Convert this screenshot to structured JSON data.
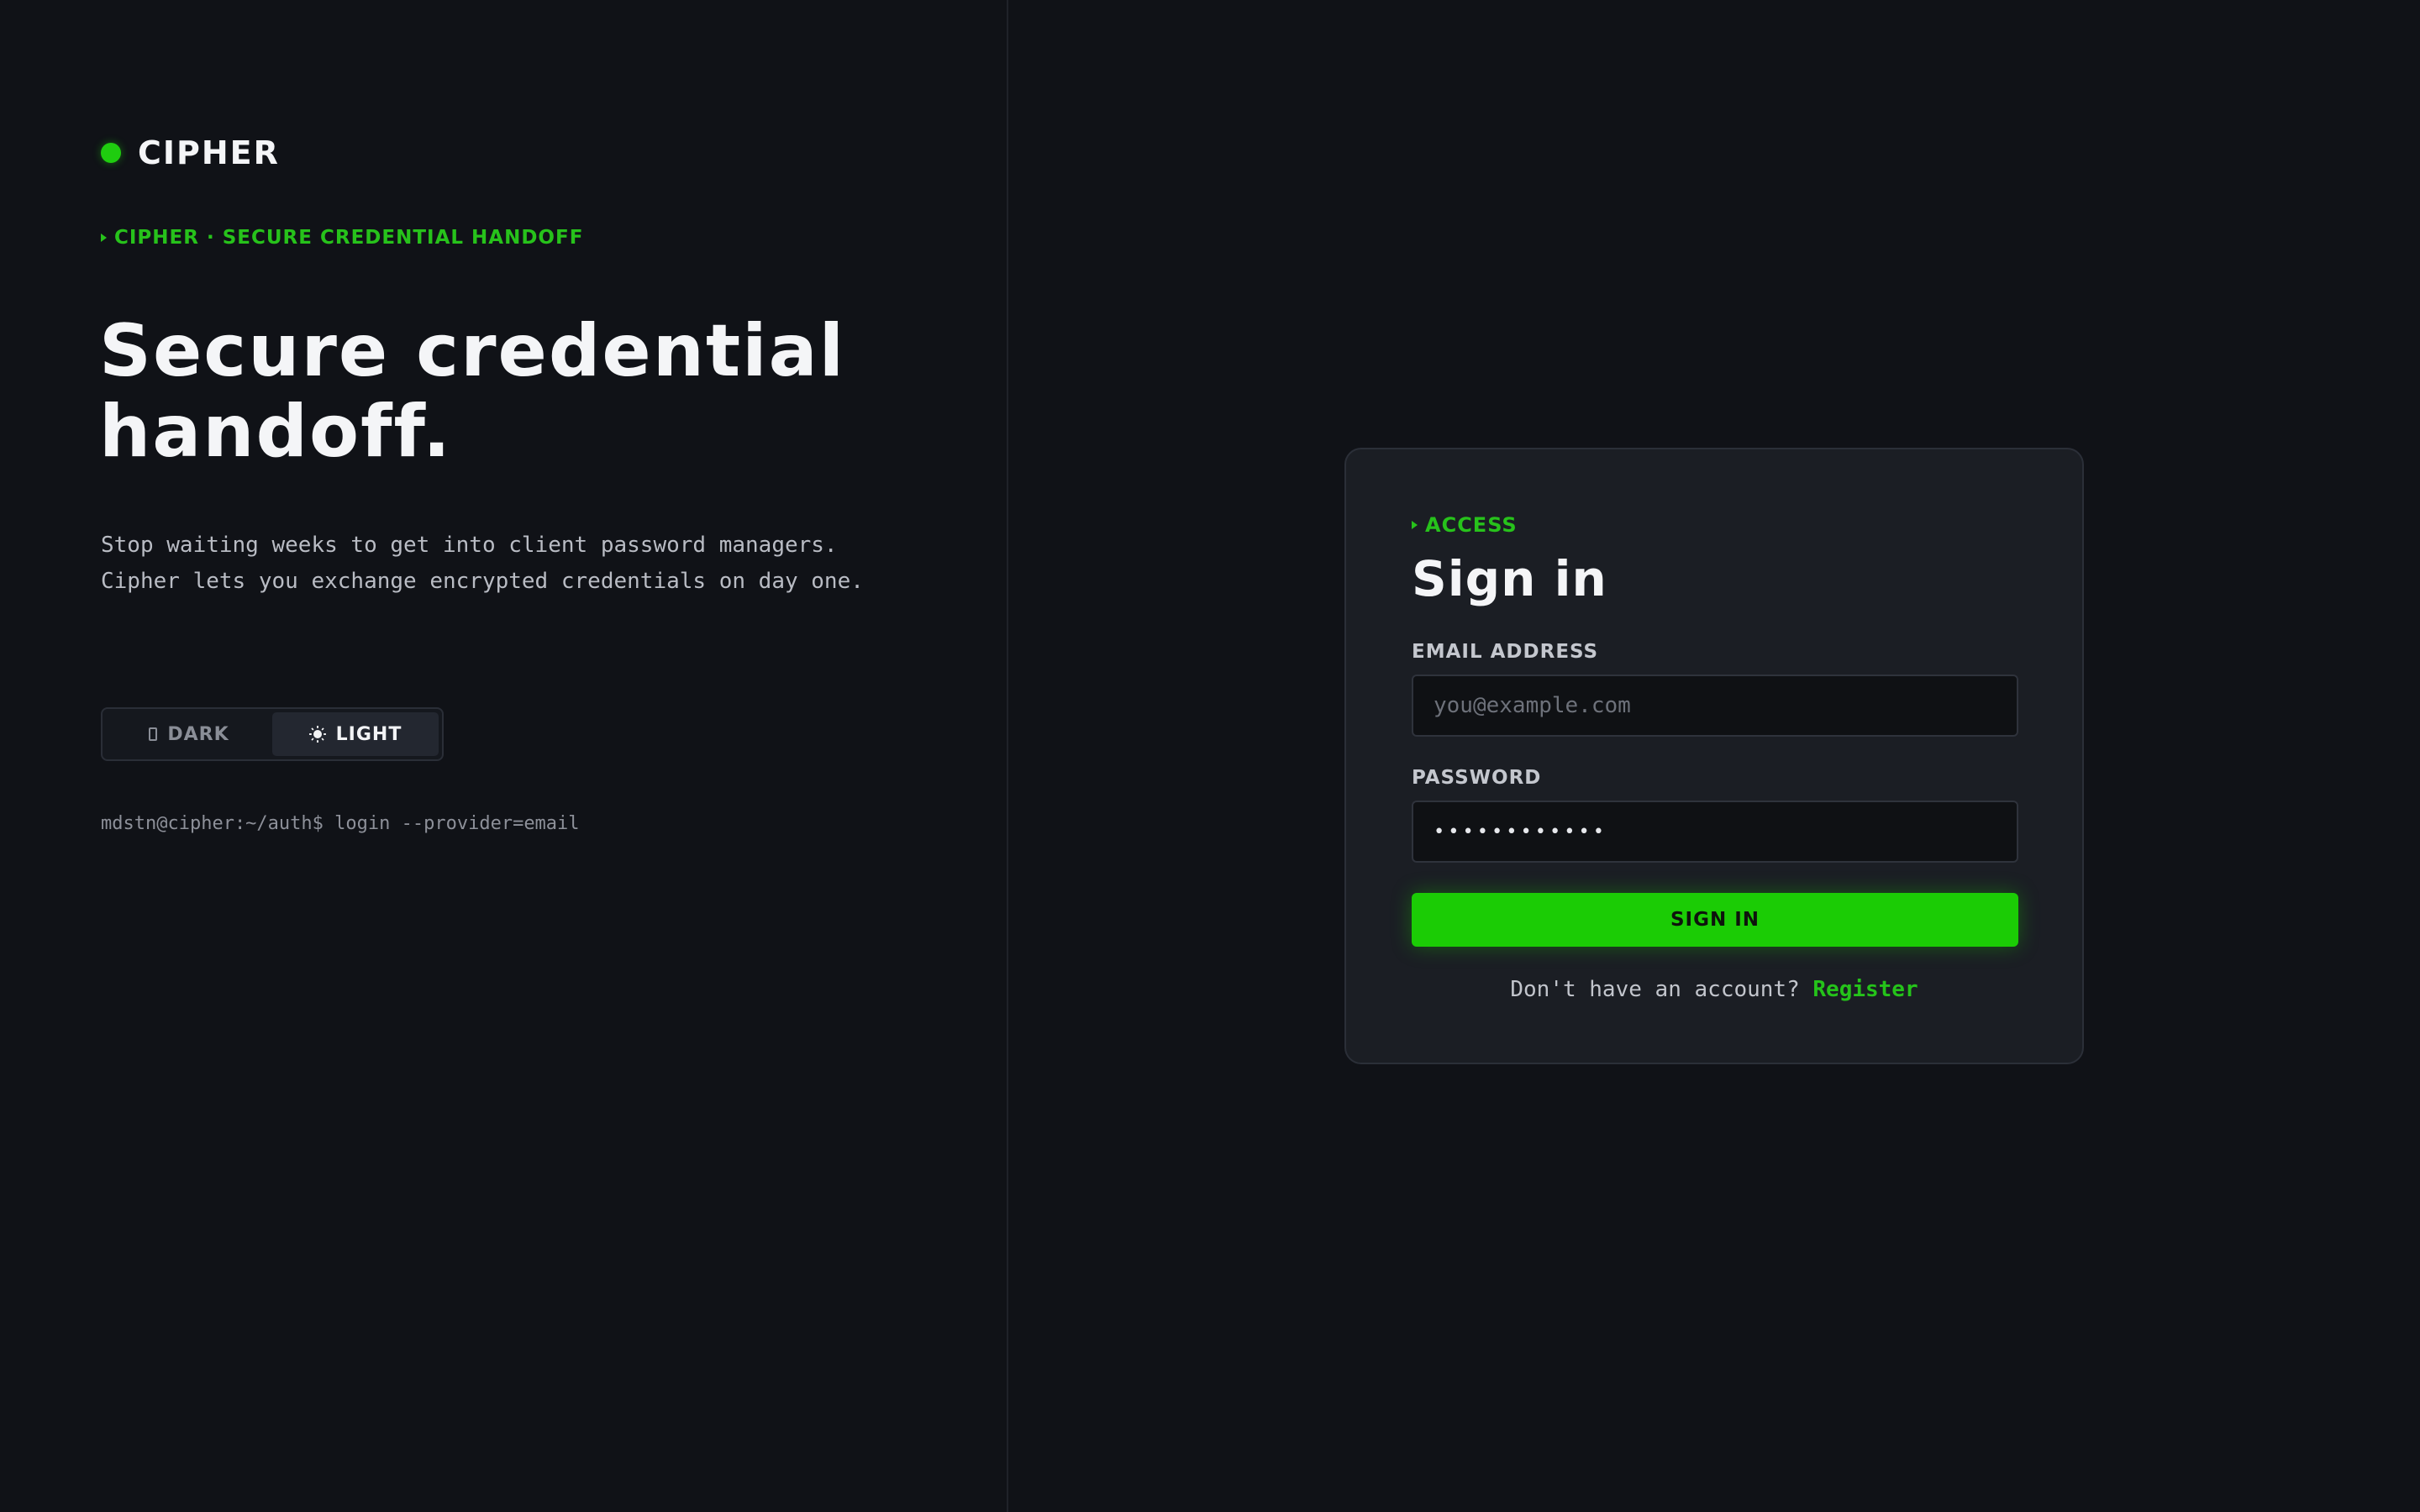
{
  "brand": {
    "name": "CIPHER",
    "accent_color": "#1fcc0f"
  },
  "hero": {
    "tagline": "CIPHER · SECURE CREDENTIAL HANDOFF",
    "headline_line1": "Secure credential",
    "headline_line2": "handoff.",
    "description_line1": "Stop waiting weeks to get into client password managers.",
    "description_line2": "Cipher lets you exchange encrypted credentials on day one."
  },
  "theme_toggle": {
    "options": [
      {
        "label": "DARK",
        "icon": "moon-icon",
        "active": false
      },
      {
        "label": "LIGHT",
        "icon": "sun-icon",
        "active": true
      }
    ]
  },
  "terminal": {
    "prompt_text": "mdstn@cipher:~/auth$ login --provider=email"
  },
  "signin_card": {
    "eyebrow": "ACCESS",
    "title": "Sign in",
    "email": {
      "label": "EMAIL ADDRESS",
      "placeholder": "you@example.com",
      "value": ""
    },
    "password": {
      "label": "PASSWORD",
      "value": "••••••••••••"
    },
    "submit_label": "SIGN IN",
    "register_prompt": "Don't have an account?",
    "register_link": "Register"
  }
}
